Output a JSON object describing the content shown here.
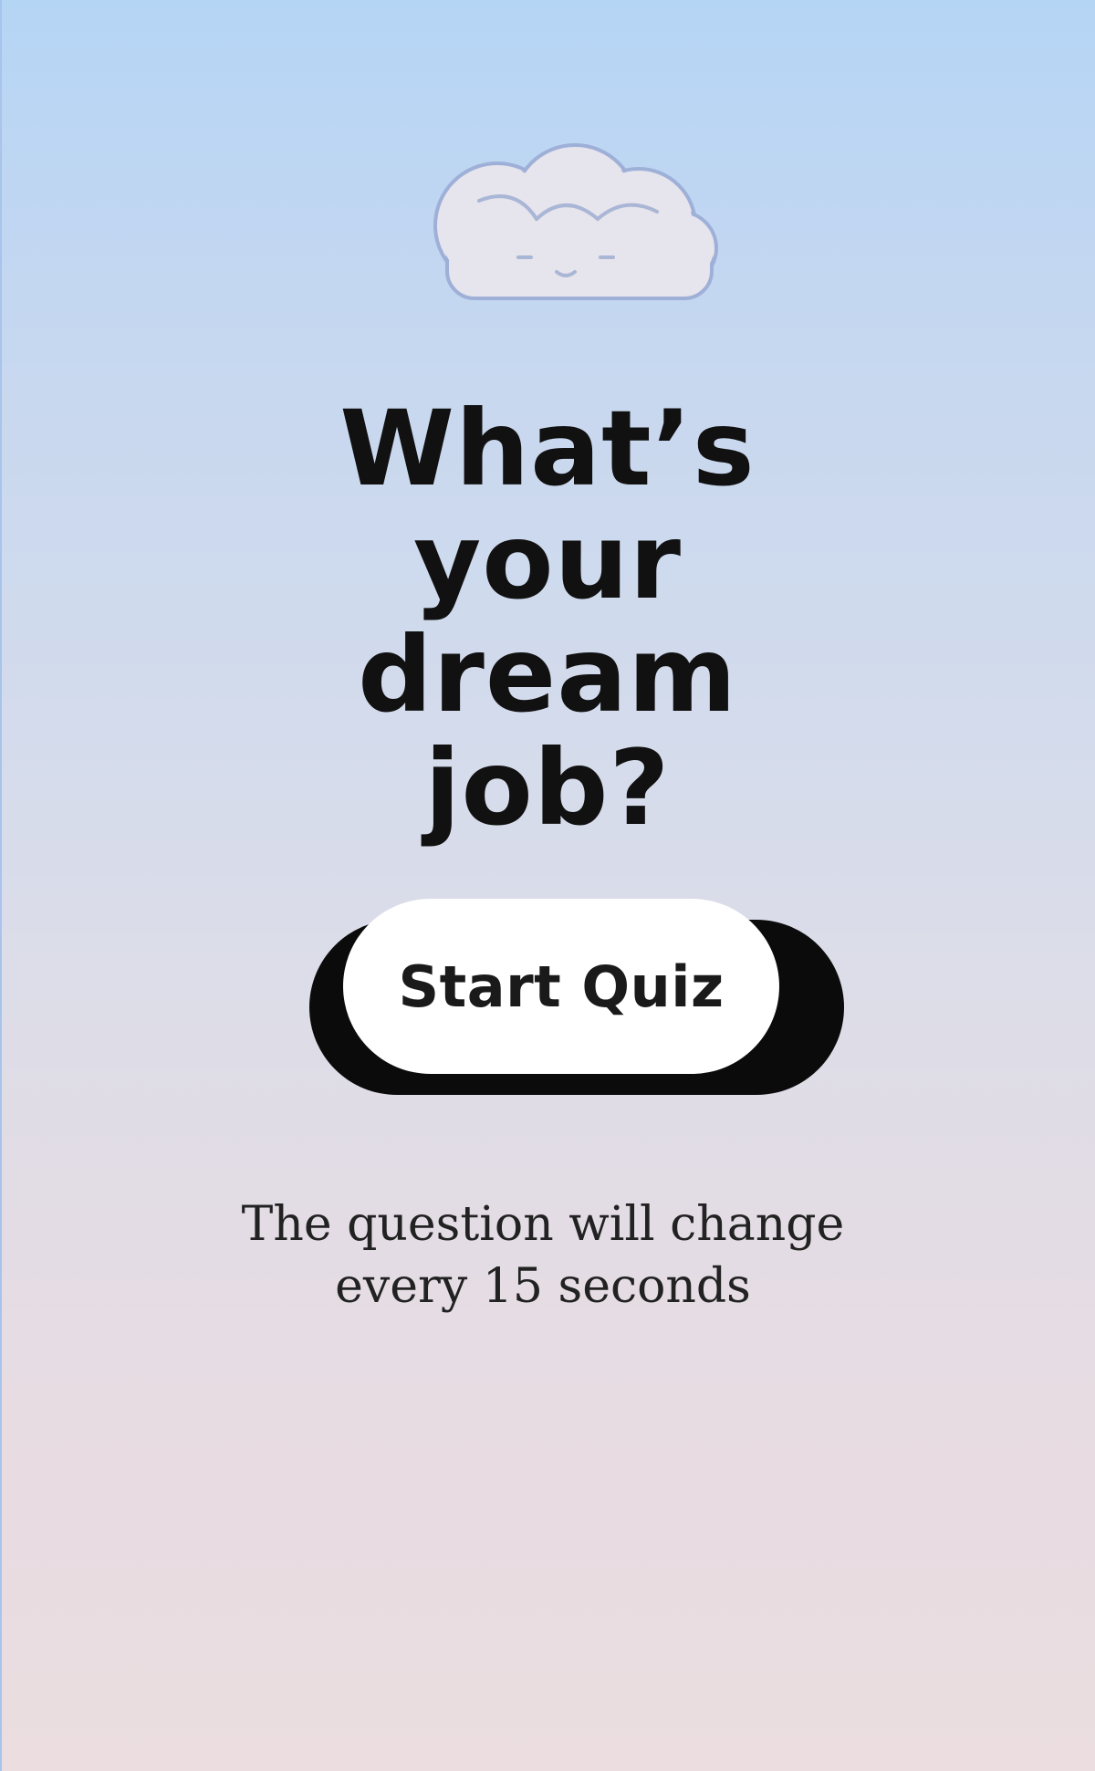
{
  "hero": {
    "title_lines": [
      "What’s",
      "your",
      "dream",
      "job?"
    ]
  },
  "cta": {
    "label": "Start Quiz"
  },
  "note": {
    "lines": [
      "The question will change",
      "every 15 seconds"
    ]
  },
  "colors": {
    "background_top": "#b5d5f5",
    "background_bottom": "#ebdde0",
    "text": "#111111",
    "button_face": "#ffffff",
    "button_shadow": "#0b0b0b",
    "cloud_fill": "#e6e4ec",
    "cloud_outline": "#9fb0d8"
  },
  "icons": {
    "hero_icon": "sleeping-cloud-icon"
  }
}
